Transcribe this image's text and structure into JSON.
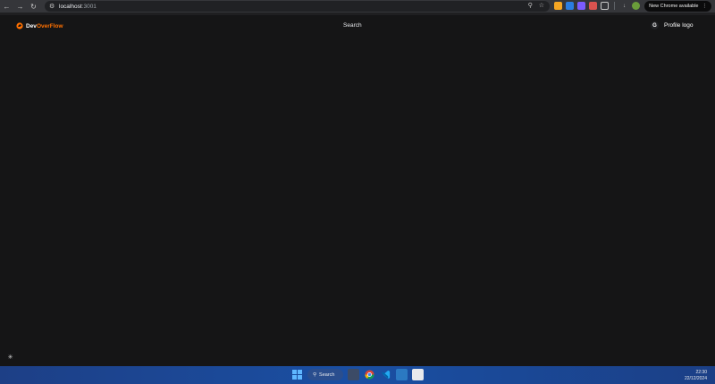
{
  "browser": {
    "url_host": "localhost",
    "url_port": ":3001",
    "update_label": "New Chrome available"
  },
  "header": {
    "logo_dev": "Dev",
    "logo_flow": "OverFlow",
    "search_label": "Search",
    "profile_initial": "G",
    "profile_label": "Profile logo"
  },
  "taskbar": {
    "search_label": "Search",
    "time": "22:30",
    "date": "22/12/2024"
  },
  "colors": {
    "brand_orange": "#ff7000",
    "background": "#151516",
    "taskbar": "#1a4fa3"
  }
}
